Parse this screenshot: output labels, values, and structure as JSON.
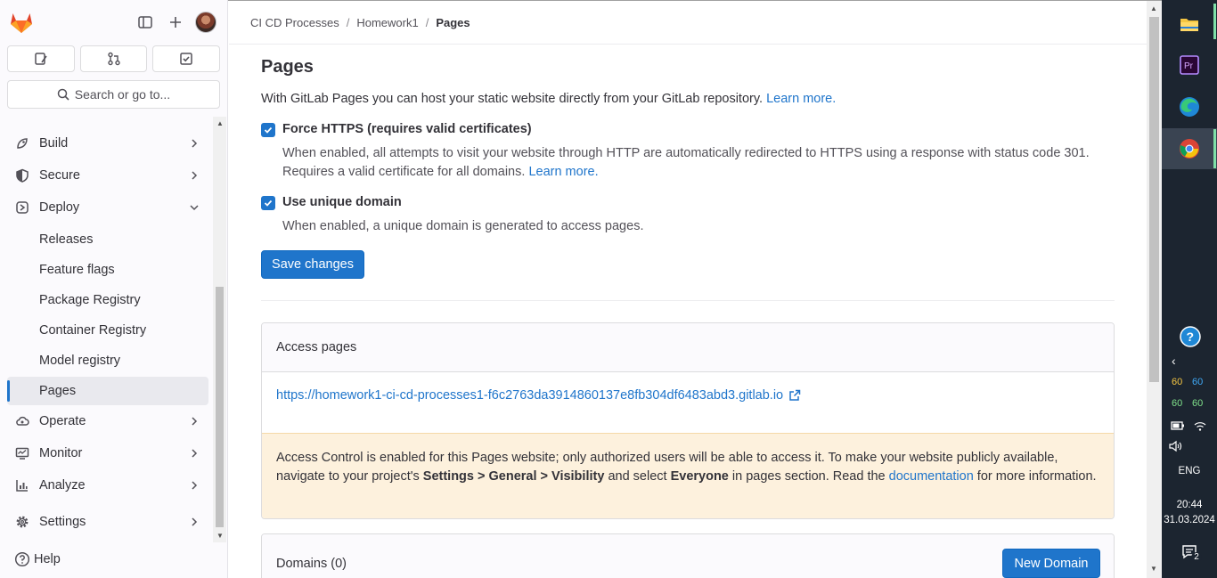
{
  "breadcrumb": [
    "CI CD Processes",
    "Homework1",
    "Pages"
  ],
  "sidebar": {
    "search_label": "Search or go to...",
    "nav": [
      {
        "label": "Build"
      },
      {
        "label": "Secure"
      },
      {
        "label": "Deploy"
      },
      {
        "label": "Releases"
      },
      {
        "label": "Feature flags"
      },
      {
        "label": "Package Registry"
      },
      {
        "label": "Container Registry"
      },
      {
        "label": "Model registry"
      },
      {
        "label": "Pages"
      },
      {
        "label": "Operate"
      },
      {
        "label": "Monitor"
      },
      {
        "label": "Analyze"
      },
      {
        "label": "Settings"
      }
    ],
    "help_label": "Help"
  },
  "page": {
    "title": "Pages",
    "intro": "With GitLab Pages you can host your static website directly from your GitLab repository.",
    "learn_more": "Learn more.",
    "force_https": {
      "label": "Force HTTPS (requires valid certificates)",
      "help_line1": "When enabled, all attempts to visit your website through HTTP are automatically redirected to HTTPS using a response with status code 301.",
      "help_line2": "Requires a valid certificate for all domains.",
      "learn_more": "Learn more.",
      "checked": true
    },
    "unique_domain": {
      "label": "Use unique domain",
      "help": "When enabled, a unique domain is generated to access pages.",
      "checked": true
    },
    "save_button": "Save changes",
    "access": {
      "title": "Access pages",
      "url": "https://homework1-ci-cd-processes1-f6c2763da3914860137e8fb304df6483abd3.gitlab.io",
      "warning_p1": "Access Control is enabled for this Pages website; only authorized users will be able to access it. To make your website publicly available, navigate to your project's",
      "warning_b1": "Settings > General > Visibility",
      "warning_p2": "and select",
      "warning_b2": "Everyone",
      "warning_p3": "in pages section. Read the",
      "warning_link": "documentation",
      "warning_p4": "for more information."
    },
    "domains": {
      "title": "Domains (0)",
      "new_button": "New Domain"
    }
  },
  "taskbar": {
    "nums": [
      "60",
      "60",
      "60",
      "60"
    ],
    "lang": "ENG",
    "time": "20:44",
    "date": "31.03.2024",
    "notif_count": "2"
  }
}
